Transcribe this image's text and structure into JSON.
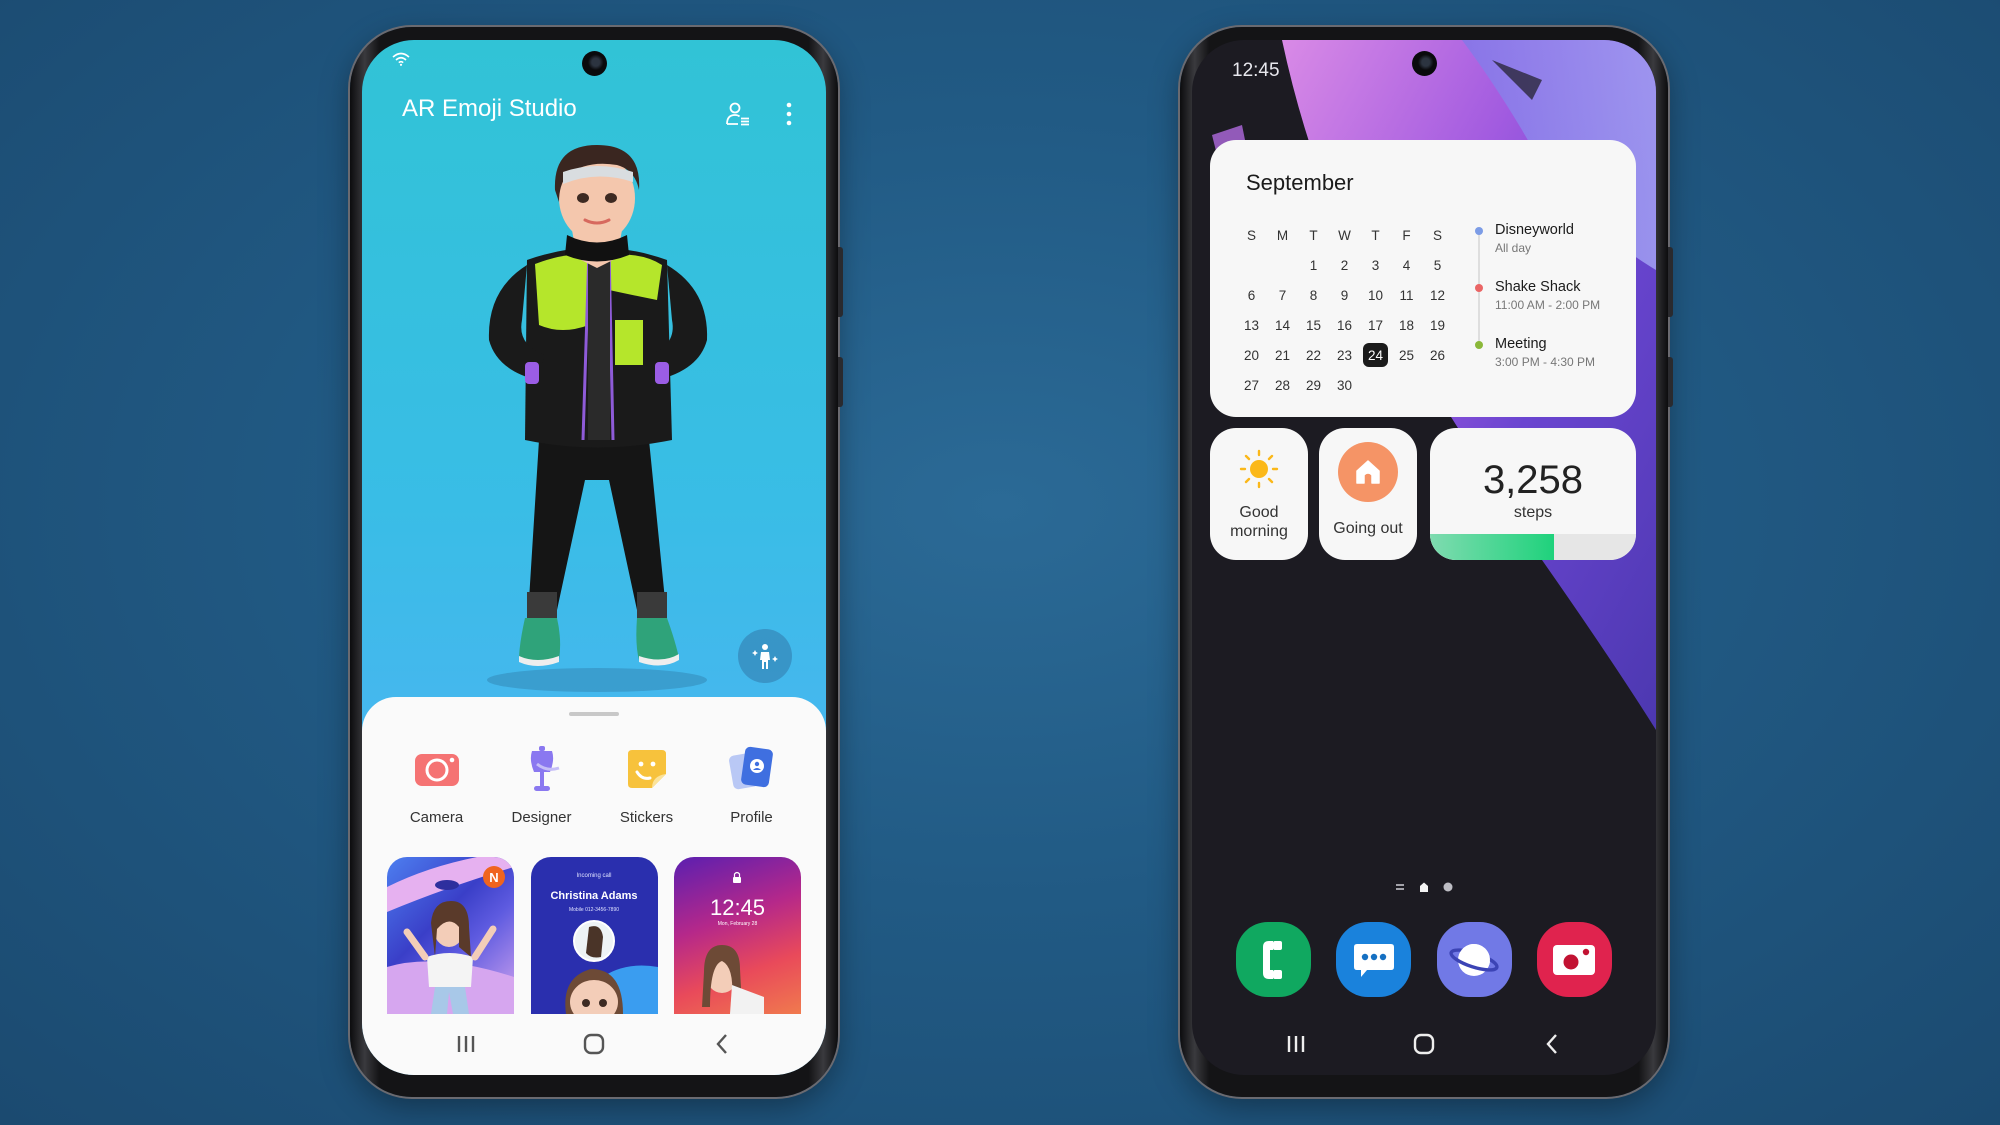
{
  "left_phone": {
    "app_title": "AR Emoji Studio",
    "status_icons": [
      "wifi-icon"
    ],
    "header_actions": [
      {
        "name": "profile-list-icon"
      },
      {
        "name": "more-options-icon"
      }
    ],
    "fab_icon": "avatar-pose-icon",
    "menu": [
      {
        "label": "Camera",
        "icon": "camera-icon",
        "color": "#f57373"
      },
      {
        "label": "Designer",
        "icon": "mannequin-icon",
        "color": "#8a78f0"
      },
      {
        "label": "Stickers",
        "icon": "sticker-icon",
        "color": "#f7c23c"
      },
      {
        "label": "Profile",
        "icon": "profile-card-icon",
        "color": "#3f6fe0"
      }
    ],
    "thumbnails": [
      {
        "name": "avatar-wallpaper-thumbnail",
        "badge": "N"
      },
      {
        "name": "incoming-call-thumbnail",
        "caption": "Incoming call",
        "contact": "Christina Adams",
        "detail": "Mobile 012-3456-7890"
      },
      {
        "name": "lock-screen-thumbnail",
        "time": "12:45",
        "date": "Mon, February 28"
      }
    ],
    "navbar": [
      "recent-apps-icon",
      "home-icon",
      "back-icon"
    ]
  },
  "right_phone": {
    "status_time": "12:45",
    "calendar": {
      "month": "September",
      "weekdays": [
        "S",
        "M",
        "T",
        "W",
        "T",
        "F",
        "S"
      ],
      "leading_blanks": 2,
      "days": 30,
      "today": 24,
      "events": [
        {
          "title": "Disneyworld",
          "time": "All day",
          "color": "#7c9ce6"
        },
        {
          "title": "Shake Shack",
          "time": "11:00 AM - 2:00 PM",
          "color": "#ea6565"
        },
        {
          "title": "Meeting",
          "time": "3:00 PM - 4:30 PM",
          "color": "#8bb83a"
        }
      ]
    },
    "weather_widget": {
      "label_line1": "Good",
      "label_line2": "morning",
      "icon": "sun-icon"
    },
    "mode_widget": {
      "label": "Going out",
      "icon": "home-icon",
      "color": "#f59466"
    },
    "steps_widget": {
      "value": "3,258",
      "unit": "steps",
      "progress_fraction": 0.6
    },
    "pager": [
      "menu-page-indicator",
      "home-page-indicator",
      "page-dot-indicator"
    ],
    "dock": [
      {
        "name": "phone-app",
        "icon": "phone-icon",
        "color": "#10a860"
      },
      {
        "name": "messages-app",
        "icon": "chat-bubble-icon",
        "color": "#1a82dc"
      },
      {
        "name": "internet-app",
        "icon": "planet-icon",
        "color": "#7179e6"
      },
      {
        "name": "camera-app",
        "icon": "camera-icon",
        "color": "#e0234e"
      }
    ],
    "navbar": [
      "recent-apps-icon",
      "home-icon",
      "back-icon"
    ]
  }
}
